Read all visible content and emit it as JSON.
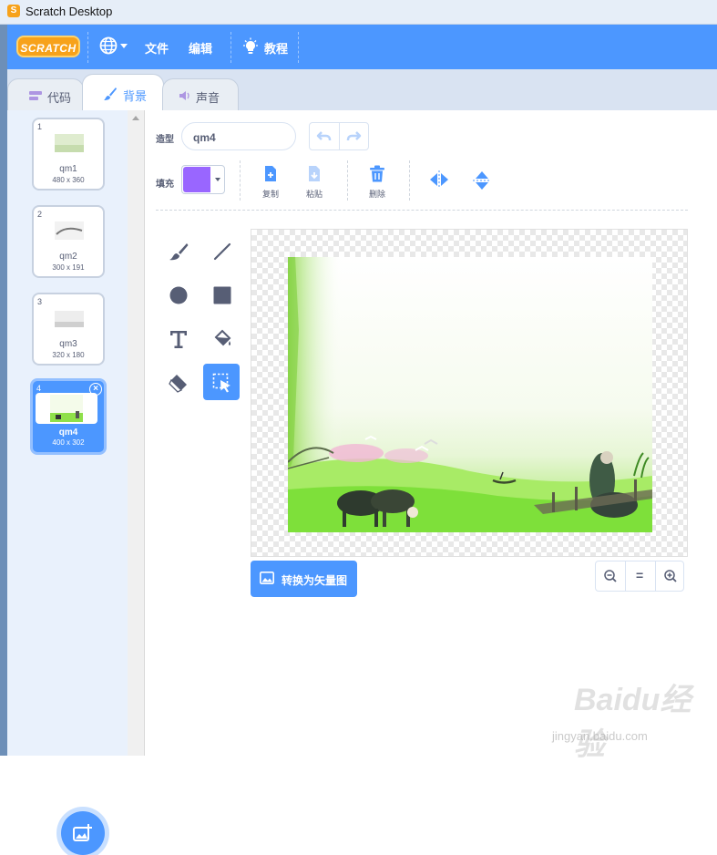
{
  "window": {
    "title": "Scratch Desktop"
  },
  "menubar": {
    "logo": "SCRATCH",
    "items": [
      "文件",
      "编辑"
    ],
    "tutorials": "教程"
  },
  "tabs": [
    {
      "label": "代码",
      "icon": "code-icon"
    },
    {
      "label": "背景",
      "icon": "brush-icon"
    },
    {
      "label": "声音",
      "icon": "speaker-icon"
    }
  ],
  "backdrops": [
    {
      "num": "1",
      "name": "qm1",
      "size": "480 x 360"
    },
    {
      "num": "2",
      "name": "qm2",
      "size": "300 x 191"
    },
    {
      "num": "3",
      "name": "qm3",
      "size": "320 x 180"
    },
    {
      "num": "4",
      "name": "qm4",
      "size": "400 x 302",
      "selected": true
    }
  ],
  "editor": {
    "costume_label": "造型",
    "costume_name": "qm4",
    "fill_label": "填充",
    "fill_color": "#9966ff",
    "copy": "复制",
    "paste": "粘贴",
    "delete": "删除",
    "convert_button": "转换为矢量图",
    "tools": [
      "brush-icon",
      "line-icon",
      "circle-icon",
      "rectangle-icon",
      "text-icon",
      "fill-icon",
      "eraser-icon",
      "select-icon"
    ],
    "zoom": {
      "out": "zoom-out-icon",
      "reset": "=",
      "in": "zoom-in-icon"
    }
  },
  "watermark": {
    "brand": "Baidu经验",
    "url": "jingyan.baidu.com"
  },
  "colors": {
    "accent": "#4c97ff",
    "logo": "#f7a21b"
  }
}
